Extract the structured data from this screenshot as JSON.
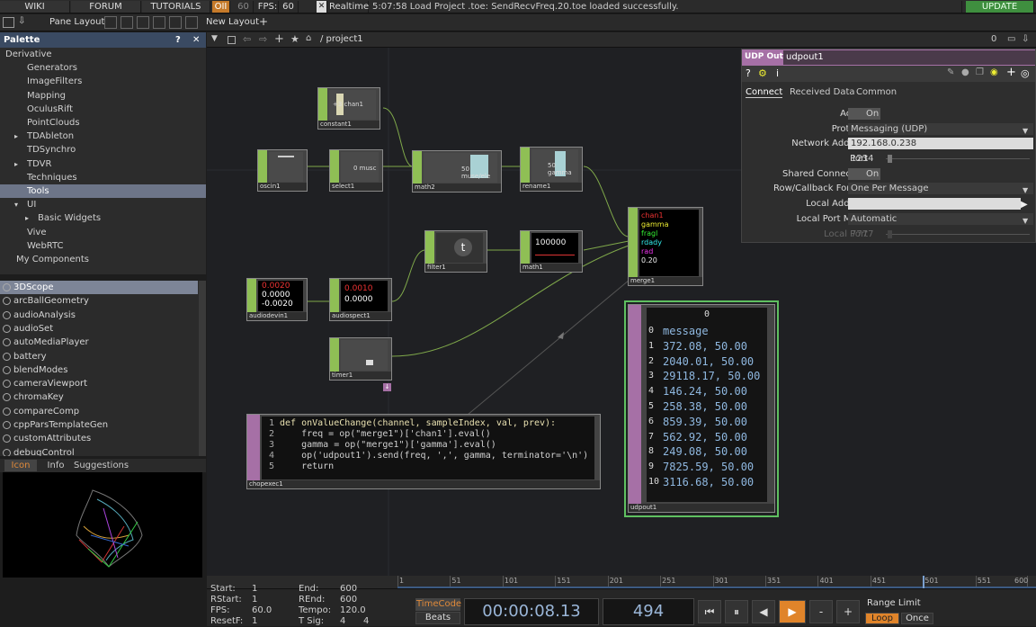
{
  "topbar": {
    "wiki": "WIKI",
    "forum": "FORUM",
    "tutorials": "TUTORIALS",
    "oii": "OII",
    "fps_limit": "60",
    "fps_label": "FPS:",
    "fps_value": "60",
    "realtime": "Realtime",
    "status": "5:07:58 Load Project .toe: SendRecvFreq.20.toe loaded successfully.",
    "update": "UPDATE"
  },
  "secondbar": {
    "pane_layout": "Pane Layout",
    "new_layout": "New Layout"
  },
  "palette": {
    "title": "Palette",
    "tree": [
      {
        "label": "Derivative",
        "indent": 0,
        "arrow": "▾"
      },
      {
        "label": "Generators",
        "indent": 2,
        "arrow": ""
      },
      {
        "label": "ImageFilters",
        "indent": 2,
        "arrow": ""
      },
      {
        "label": "Mapping",
        "indent": 2,
        "arrow": ""
      },
      {
        "label": "OculusRift",
        "indent": 2,
        "arrow": ""
      },
      {
        "label": "PointClouds",
        "indent": 2,
        "arrow": ""
      },
      {
        "label": "TDAbleton",
        "indent": 2,
        "arrow": "▸"
      },
      {
        "label": "TDSynchro",
        "indent": 2,
        "arrow": ""
      },
      {
        "label": "TDVR",
        "indent": 2,
        "arrow": "▸"
      },
      {
        "label": "Techniques",
        "indent": 2,
        "arrow": ""
      },
      {
        "label": "Tools",
        "indent": 2,
        "arrow": "",
        "selected": true
      },
      {
        "label": "UI",
        "indent": 2,
        "arrow": "▾"
      },
      {
        "label": "Basic Widgets",
        "indent": 3,
        "arrow": "▸"
      },
      {
        "label": "Vive",
        "indent": 2,
        "arrow": ""
      },
      {
        "label": "WebRTC",
        "indent": 2,
        "arrow": ""
      },
      {
        "label": "My Components",
        "indent": 1,
        "arrow": ""
      }
    ],
    "components": [
      "3DScope",
      "arcBallGeometry",
      "audioAnalysis",
      "audioSet",
      "autoMediaPlayer",
      "battery",
      "blendModes",
      "cameraViewport",
      "chromaKey",
      "compareComp",
      "cppParsTemplateGen",
      "customAttributes",
      "debugControl"
    ],
    "tabs": [
      "Icon",
      "Info",
      "Suggestions"
    ]
  },
  "network": {
    "path": "/ project1",
    "zoom": "0",
    "nodes": {
      "constant1": {
        "name": "constant1",
        "text": "+3 chan1"
      },
      "oscin1": {
        "name": "oscin1"
      },
      "select1": {
        "name": "select1",
        "text": "0 musc"
      },
      "math2": {
        "name": "math2",
        "text": "50 muse/ele"
      },
      "rename1": {
        "name": "rename1",
        "text": "50 gamma"
      },
      "filter1": {
        "name": "filter1"
      },
      "math1": {
        "name": "math1",
        "text": "100000"
      },
      "merge1": {
        "name": "merge1",
        "lines": [
          "chan1",
          "gamma",
          "fragl",
          "rdady",
          "rad",
          "0.20"
        ]
      },
      "audiodevin1": {
        "name": "audiodevin1",
        "lines": [
          "0.0020",
          "0.0000",
          "-0.0020"
        ]
      },
      "audiospect1": {
        "name": "audiospect1",
        "lines": [
          "0.0010",
          "0.0000"
        ]
      },
      "timer1": {
        "name": "timer1"
      },
      "chopexec1": {
        "name": "chopexec1"
      },
      "udpout1": {
        "name": "udpout1"
      }
    },
    "code": [
      "def onValueChange(channel, sampleIndex, val, prev):",
      "    freq = op(\"merge1\")['chan1'].eval()",
      "    gamma = op(\"merge1\")['gamma'].eval()",
      "    op('udpout1').send(freq, ',', gamma, terminator='\\n')",
      "    return"
    ],
    "table": {
      "header": "0",
      "rows": [
        "message",
        "372.08, 50.00",
        "2040.01, 50.00",
        "29118.17, 50.00",
        "146.24, 50.00",
        "258.38, 50.00",
        "859.39, 50.00",
        "562.92, 50.00",
        "249.08, 50.00",
        "7825.59, 50.00",
        "3116.68, 50.00"
      ]
    }
  },
  "params": {
    "type": "UDP Out",
    "name": "udpout1",
    "tabs": [
      "Connect",
      "Received Data",
      "Common"
    ],
    "rows": [
      {
        "label": "Active",
        "value": "On"
      },
      {
        "label": "Protocol",
        "value": "Messaging (UDP)"
      },
      {
        "label": "Network Address",
        "value": "192.168.0.238"
      },
      {
        "label": "Port",
        "value": "1234"
      },
      {
        "label": "Shared Connection",
        "value": "On"
      },
      {
        "label": "Row/Callback Format",
        "value": "One Per Message"
      },
      {
        "label": "Local Address",
        "value": ""
      },
      {
        "label": "Local Port Mode",
        "value": "Automatic"
      },
      {
        "label": "Local Port",
        "value": "7777"
      }
    ]
  },
  "timeline": {
    "ticks": [
      "1",
      "51",
      "101",
      "151",
      "201",
      "251",
      "301",
      "351",
      "401",
      "451",
      "501",
      "551",
      "600"
    ],
    "start_label": "Start:",
    "start": "1",
    "rstart_label": "RStart:",
    "rstart": "1",
    "fps_label": "FPS:",
    "fps": "60.0",
    "resetf_label": "ResetF:",
    "resetf": "1",
    "end_label": "End:",
    "end": "600",
    "rend_label": "REnd:",
    "rend": "600",
    "tempo_label": "Tempo:",
    "tempo": "120.0",
    "tsig_label": "T Sig:",
    "tsig1": "4",
    "tsig2": "4",
    "timecode_label": "TimeCode",
    "beats_label": "Beats",
    "timecode": "00:00:08.13",
    "frame": "494",
    "range_limit": "Range Limit",
    "loop": "Loop",
    "once": "Once"
  },
  "colors": {
    "accent_green": "#8fbf55",
    "dat_purple": "#a670a6",
    "update_green": "#3f8f3f"
  }
}
